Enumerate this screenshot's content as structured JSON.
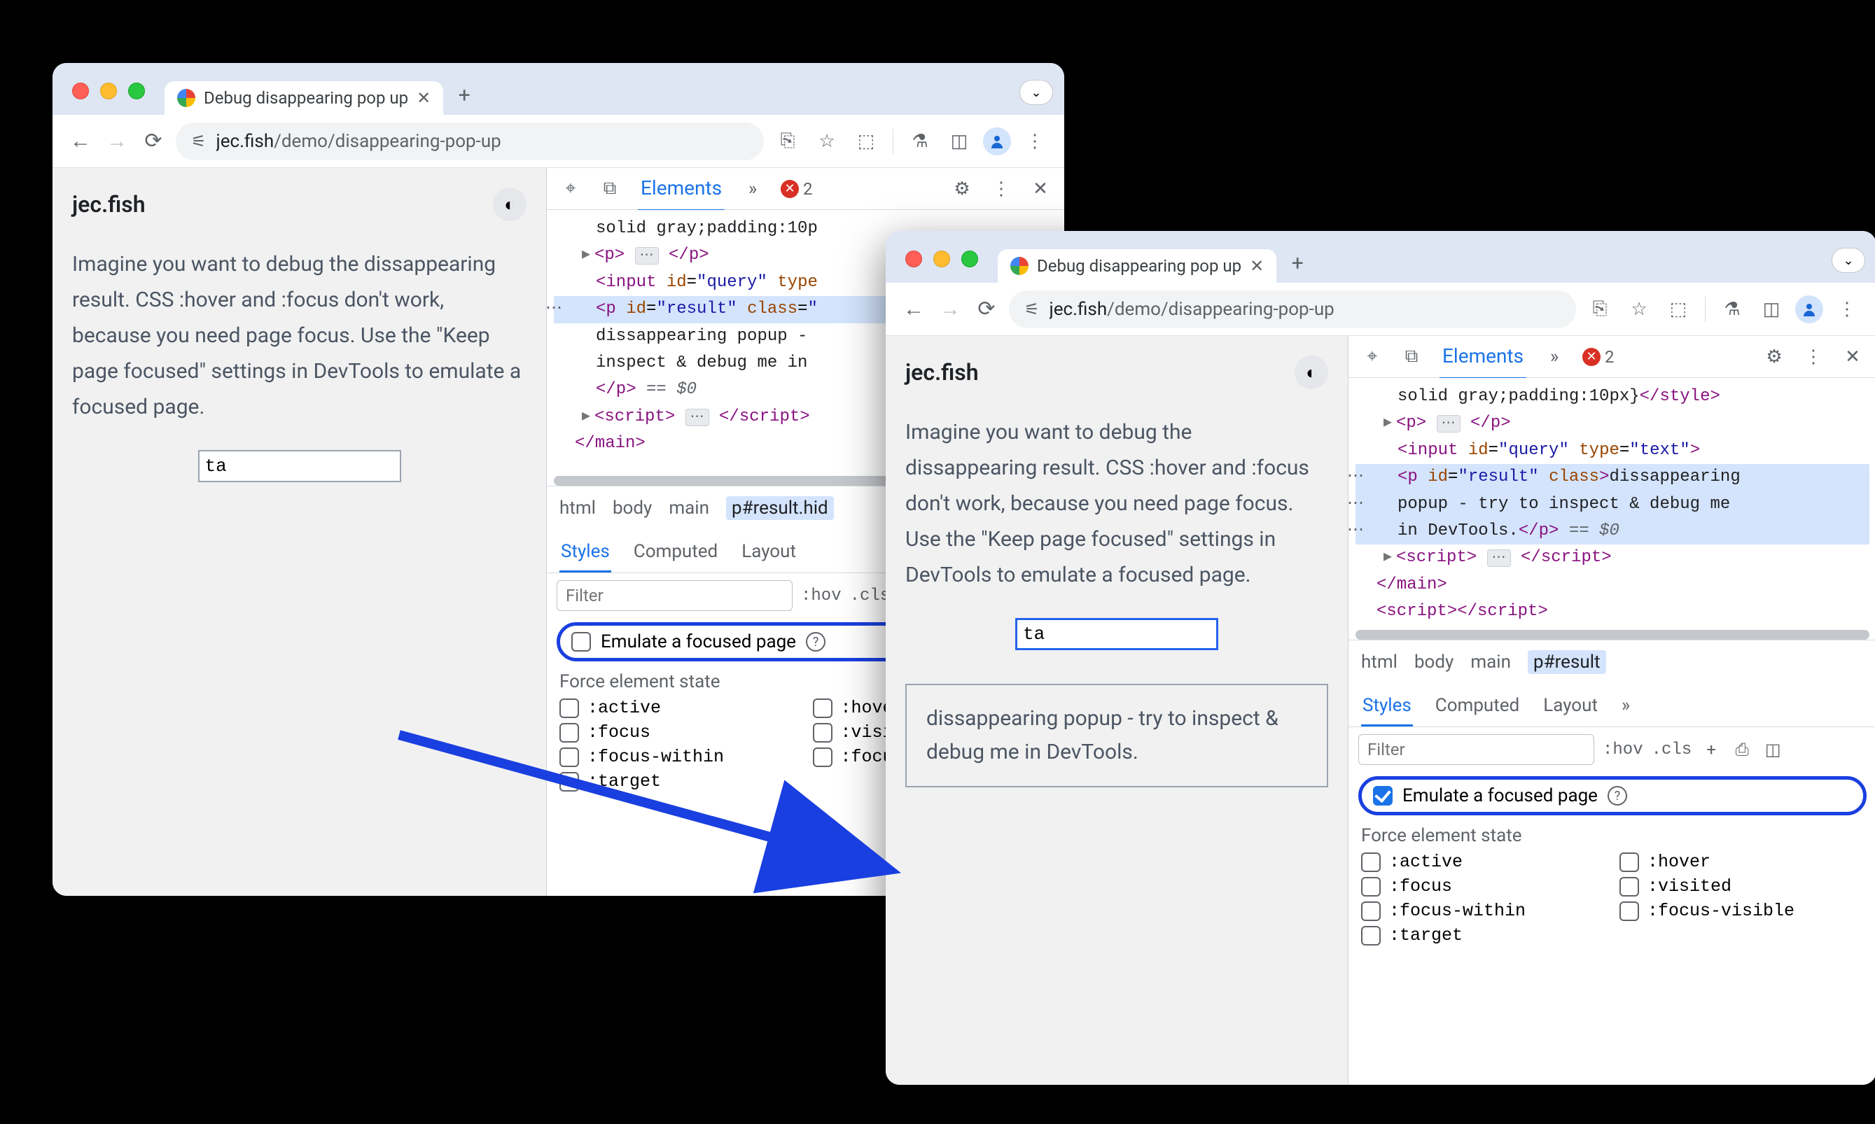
{
  "tab_title": "Debug disappearing pop up",
  "url_host": "jec.fish",
  "url_path": "/demo/disappearing-pop-up",
  "new_tab_glyph": "+",
  "nav": {
    "back": "←",
    "fwd": "→",
    "reload": "⟳"
  },
  "page": {
    "site": "jec.fish",
    "theme_icon": "◐",
    "description": "Imagine you want to debug the dissappearing result. CSS :hover and :focus don't work, because you need page focus. Use the \"Keep page focused\" settings in DevTools to emulate a focused page.",
    "query_value": "ta",
    "popup_text": "dissappearing popup - try to inspect & debug me in DevTools."
  },
  "devtools": {
    "tab_elements": "Elements",
    "more_glyph": "»",
    "err_count": "2",
    "gear": "⚙",
    "kebab": "⋮",
    "close": "✕",
    "inspect_icon": "⌖",
    "device_icon": "⧉",
    "dom": {
      "style_frag": "solid gray;padding:10p",
      "style_frag_full": "solid gray;padding:10px}",
      "style_close": "</style>",
      "p_open": "<p>",
      "p_ellipsis": "⋯",
      "p_close": "</p>",
      "input_line": "<input id=\"query\" type",
      "input_full": "<input id=\"query\" type=\"text\">",
      "result_open": "<p id=\"result\" class=\"",
      "result_open_b": "<p id=\"result\" class>",
      "result_text_1": "dissappearing popup -",
      "result_text_a": "dissappearing popup - try to inspect & debug me in DevTools.",
      "result_text_2": "inspect & debug me in",
      "result_close": "</p>",
      "eq0": " == $0",
      "script_open": "<script>",
      "script_ellipsis": "⋯",
      "script_close": "</script>",
      "main_close": "</main>",
      "script_plain": "<script></script>"
    },
    "crumbs": {
      "html": "html",
      "body": "body",
      "main": "main",
      "result_a": "p#result.hid",
      "result_b": "p#result"
    },
    "styles": {
      "tab_styles": "Styles",
      "tab_computed": "Computed",
      "tab_layout": "Layout",
      "filter_placeholder": "Filter",
      "hov": ":hov",
      "cls": ".cls",
      "emulate_label": "Emulate a focused page",
      "force_title": "Force element state",
      "states": {
        "active": ":active",
        "focus": ":focus",
        "focus_within": ":focus-within",
        "target": ":target",
        "hover": ":hover",
        "hover_cut": ":hove",
        "visited": ":visited",
        "visi_cut": ":visi",
        "focus_visible": ":focus-visible",
        "focu_cut": ":focu"
      }
    }
  }
}
